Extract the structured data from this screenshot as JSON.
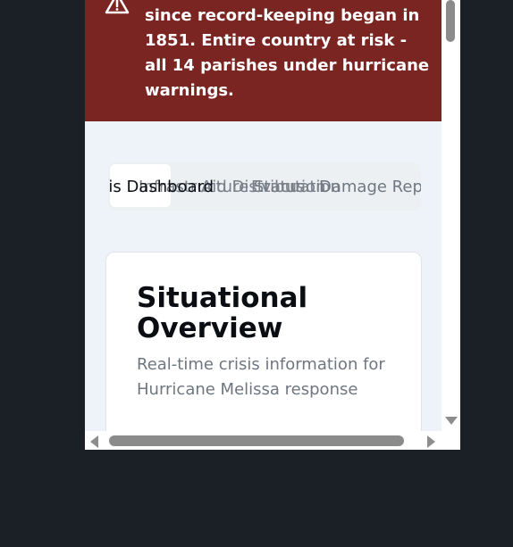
{
  "alert": {
    "icon": "warning-triangle-icon",
    "text": "since record-keeping began in 1851. Entire country at risk - all 14 parishes under hurricane warnings."
  },
  "tabs": {
    "items": [
      "Crisis Dashboard",
      "Infrastructure Status",
      "Aid Distribution",
      "Evacuation",
      "Damage Reports"
    ],
    "active_index": 0
  },
  "card": {
    "title": "Situational Overview",
    "subtitle": "Real-time crisis information for Hurricane Melissa response"
  },
  "colors": {
    "alert_bg": "#7b2523",
    "page_bg": "#eef3fa",
    "tab_bar_bg": "#edf0f3",
    "outer_bg": "#1b1f26"
  }
}
